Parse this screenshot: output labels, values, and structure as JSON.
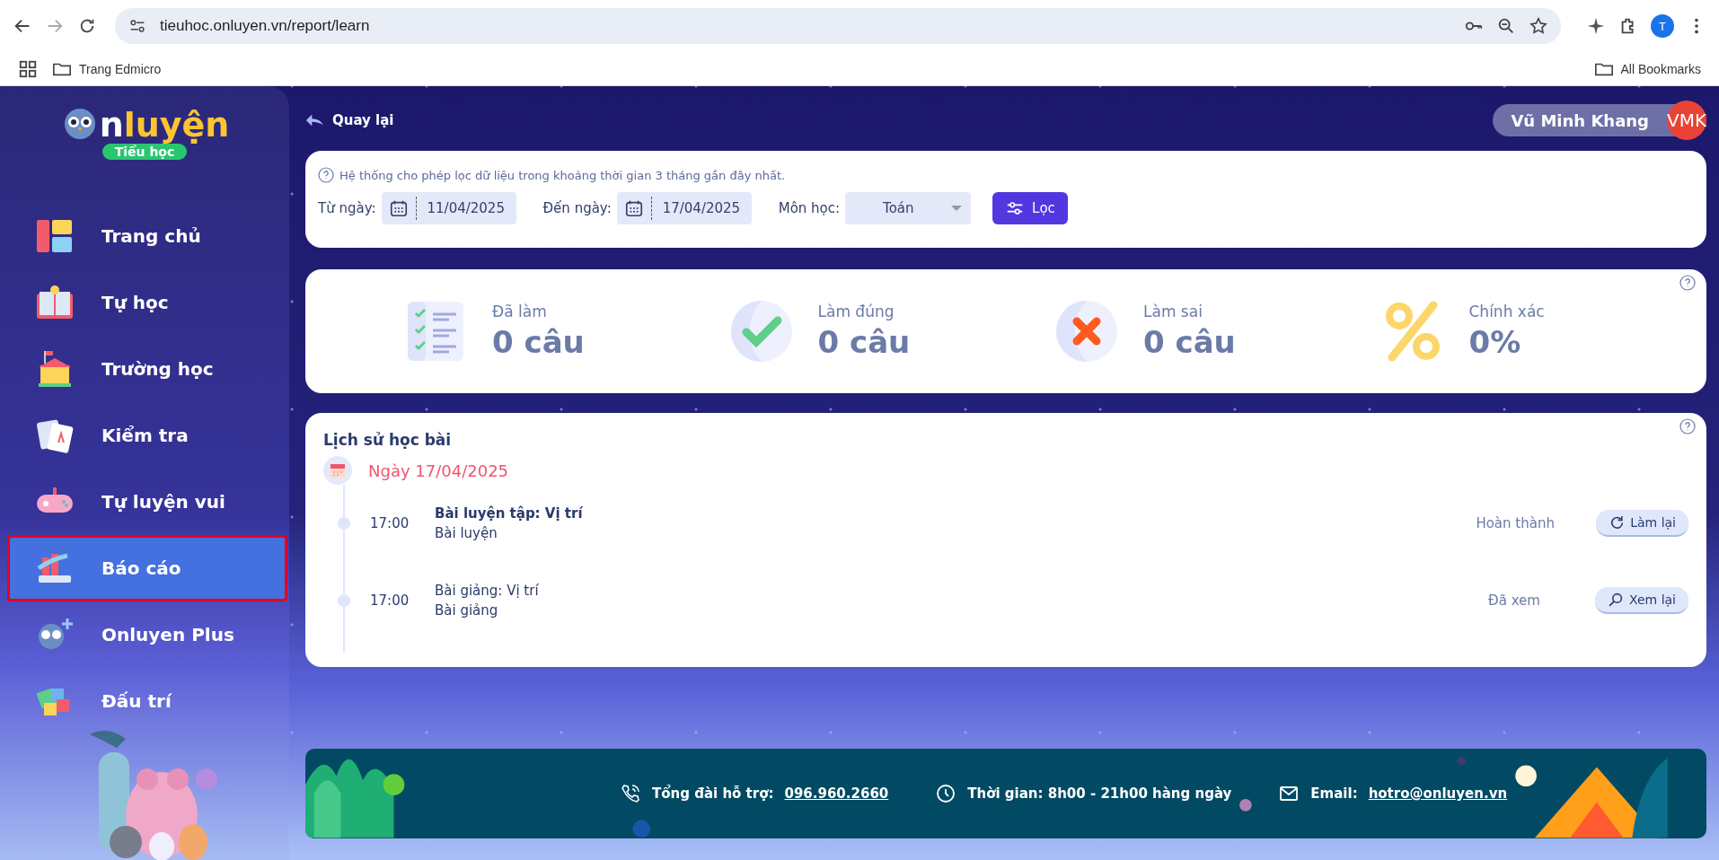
{
  "browser": {
    "url": "tieuhoc.onluyen.vn/report/learn",
    "profile_initial": "T",
    "bookmarks": [
      {
        "label": "Trang Edmicro"
      }
    ],
    "all_bookmarks": "All Bookmarks"
  },
  "sidebar": {
    "logo": {
      "letter": "n",
      "word": "luyện",
      "badge": "Tiểu học"
    },
    "items": [
      {
        "kind": "home",
        "label": "Trang chủ",
        "selected": false
      },
      {
        "kind": "book",
        "label": "Tự học",
        "selected": false
      },
      {
        "kind": "school",
        "label": "Trường học",
        "selected": false
      },
      {
        "kind": "test",
        "label": "Kiểm tra",
        "selected": false
      },
      {
        "kind": "game",
        "label": "Tự luyện vui",
        "selected": false
      },
      {
        "kind": "report",
        "label": "Báo cáo",
        "selected": true
      },
      {
        "kind": "plus",
        "label": "Onluyen Plus",
        "selected": false
      },
      {
        "kind": "puzzle",
        "label": "Đấu trí",
        "selected": false
      }
    ]
  },
  "header": {
    "back": "Quay lại",
    "user": {
      "name": "Vũ Minh Khang",
      "initials": "VMK"
    }
  },
  "filter": {
    "note": "Hệ thống cho phép lọc dữ liệu trong khoảng thời gian 3 tháng gần đây nhất.",
    "from_label": "Từ ngày:",
    "from_value": "11/04/2025",
    "to_label": "Đến ngày:",
    "to_value": "17/04/2025",
    "subject_label": "Môn học:",
    "subject_value": "Toán",
    "button": "Lọc"
  },
  "stats": [
    {
      "kind": "list",
      "label": "Đã làm",
      "value": "0 câu"
    },
    {
      "kind": "check",
      "label": "Làm đúng",
      "value": "0 câu"
    },
    {
      "kind": "cross",
      "label": "Làm sai",
      "value": "0 câu"
    },
    {
      "kind": "percent",
      "label": "Chính xác",
      "value": "0%"
    }
  ],
  "history": {
    "title": "Lịch sử học bài",
    "groups": [
      {
        "date": "Ngày 17/04/2025",
        "entries": [
          {
            "time": "17:00",
            "title": "Bài luyện tập: Vị trí",
            "emphasized": true,
            "type": "Bài luyện",
            "status": "Hoàn thành",
            "action": {
              "kind": "redo",
              "label": "Làm lại"
            }
          },
          {
            "time": "17:00",
            "title": "Bài giảng: Vị trí",
            "emphasized": false,
            "type": "Bài giảng",
            "status": "Đã xem",
            "action": {
              "kind": "view",
              "label": "Xem lại"
            }
          }
        ]
      }
    ]
  },
  "footer": {
    "items": [
      {
        "kind": "phone",
        "label": "Tổng đài hỗ trợ:",
        "link": "096.960.2660"
      },
      {
        "kind": "clock",
        "label": "Thời gian: 8h00 - 21h00 hàng ngày"
      },
      {
        "kind": "mail",
        "label": "Email:",
        "link": "hotro@onluyen.vn"
      }
    ]
  }
}
